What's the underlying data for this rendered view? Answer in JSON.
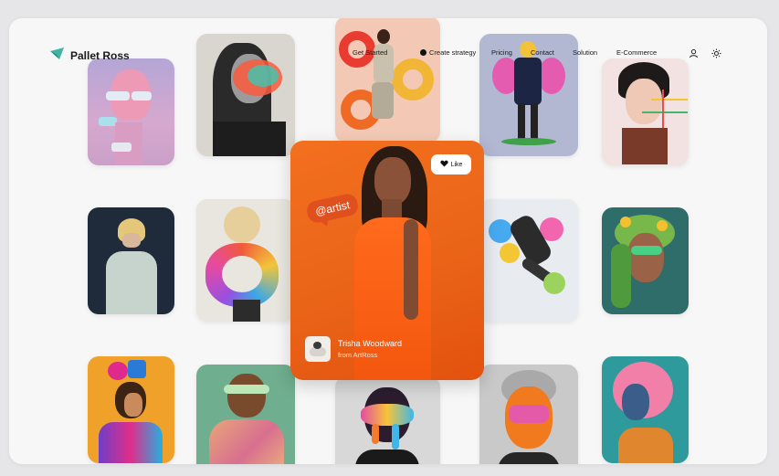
{
  "brand": {
    "name": "Pallet Ross",
    "icon": "paper-plane-icon"
  },
  "nav": {
    "links": [
      "Get Started",
      "Create strategy",
      "Pricing",
      "Contact",
      "Solution",
      "E-Commerce"
    ],
    "user_icon": "user-icon",
    "theme_icon": "sun-icon"
  },
  "featured": {
    "tag": "@artist",
    "like_label": "Like",
    "author_name": "Trisha Woodward",
    "author_source": "from ArtRoss"
  },
  "colors": {
    "accent": "#ea6418",
    "background": "#f7f7f7"
  }
}
